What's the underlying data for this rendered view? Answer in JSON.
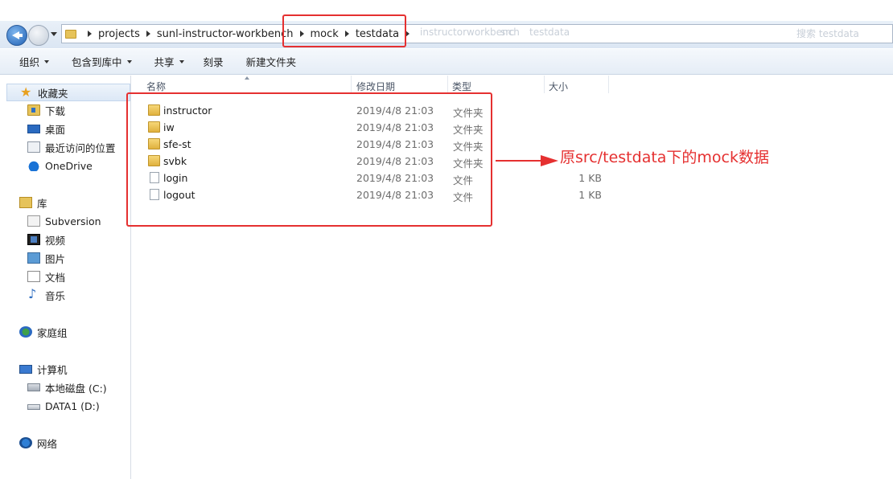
{
  "breadcrumb": {
    "items": [
      "projects",
      "sunl-instructor-workbench",
      "mock",
      "testdata"
    ],
    "ghost_items": [
      "instructorworkbench",
      "src",
      "testdata"
    ],
    "ghost_search": "搜索 testdata"
  },
  "toolbar": {
    "organize": "组织",
    "include_in_library": "包含到库中",
    "share": "共享",
    "burn": "刻录",
    "new_folder": "新建文件夹"
  },
  "sidebar": {
    "favorites": "收藏夹",
    "downloads": "下载",
    "desktop": "桌面",
    "recent": "最近访问的位置",
    "onedrive": "OneDrive",
    "libraries": "库",
    "subversion": "Subversion",
    "videos": "视频",
    "pictures": "图片",
    "documents": "文档",
    "music": "音乐",
    "homegroup": "家庭组",
    "computer": "计算机",
    "local_disk": "本地磁盘 (C:)",
    "data1": "DATA1 (D:)",
    "network": "网络"
  },
  "columns": {
    "name": "名称",
    "modified": "修改日期",
    "type": "类型",
    "size": "大小"
  },
  "files": [
    {
      "name": "instructor",
      "modified": "2019/4/8 21:03",
      "type": "文件夹",
      "size": "",
      "kind": "folder"
    },
    {
      "name": "iw",
      "modified": "2019/4/8 21:03",
      "type": "文件夹",
      "size": "",
      "kind": "folder"
    },
    {
      "name": "sfe-st",
      "modified": "2019/4/8 21:03",
      "type": "文件夹",
      "size": "",
      "kind": "folder"
    },
    {
      "name": "svbk",
      "modified": "2019/4/8 21:03",
      "type": "文件夹",
      "size": "",
      "kind": "folder"
    },
    {
      "name": "login",
      "modified": "2019/4/8 21:03",
      "type": "文件",
      "size": "1 KB",
      "kind": "file"
    },
    {
      "name": "logout",
      "modified": "2019/4/8 21:03",
      "type": "文件",
      "size": "1 KB",
      "kind": "file"
    }
  ],
  "annotation": {
    "text": "原src/testdata下的mock数据",
    "color": "#e53030"
  }
}
